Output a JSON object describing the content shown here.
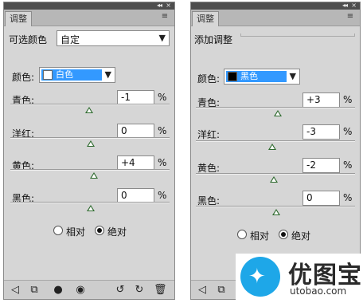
{
  "left_panel": {
    "window_controls": {
      "collapse": "◂◂",
      "close": "×"
    },
    "tab": "调整",
    "menu_icon": "≡",
    "preset_label": "可选颜色",
    "preset_value": "自定",
    "color_label": "颜色:",
    "color_value": "白色",
    "color_swatch": "#ffffff",
    "sliders": [
      {
        "label": "青色:",
        "value": "-1",
        "unit": "%"
      },
      {
        "label": "洋红:",
        "value": "0",
        "unit": "%"
      },
      {
        "label": "黄色:",
        "value": "+4",
        "unit": "%"
      },
      {
        "label": "黑色:",
        "value": "0",
        "unit": "%"
      }
    ],
    "method_relative": "相对",
    "method_absolute": "绝对",
    "method_selected": "绝对"
  },
  "right_panel": {
    "window_controls": {
      "collapse": "◂◂",
      "close": "×"
    },
    "tab": "调整",
    "menu_icon": "≡",
    "header_label": "添加调整",
    "color_label": "颜色:",
    "color_value": "黑色",
    "color_swatch": "#000000",
    "sliders": [
      {
        "label": "青色:",
        "value": "+3",
        "unit": "%"
      },
      {
        "label": "洋红:",
        "value": "-3",
        "unit": "%"
      },
      {
        "label": "黄色:",
        "value": "-2",
        "unit": "%"
      },
      {
        "label": "黑色:",
        "value": "0",
        "unit": "%"
      }
    ],
    "method_relative": "相对",
    "method_absolute": "绝对",
    "method_selected": "绝对"
  },
  "bottom_icons": [
    "back-icon",
    "fit-icon",
    "mask-icon",
    "eye-icon",
    "reset-icon",
    "refresh-icon",
    "trash-icon"
  ],
  "accent_color": "#3399ff",
  "watermark": {
    "brand": "优图宝",
    "site": "utobao.com",
    "color": "#1ea7e8"
  }
}
